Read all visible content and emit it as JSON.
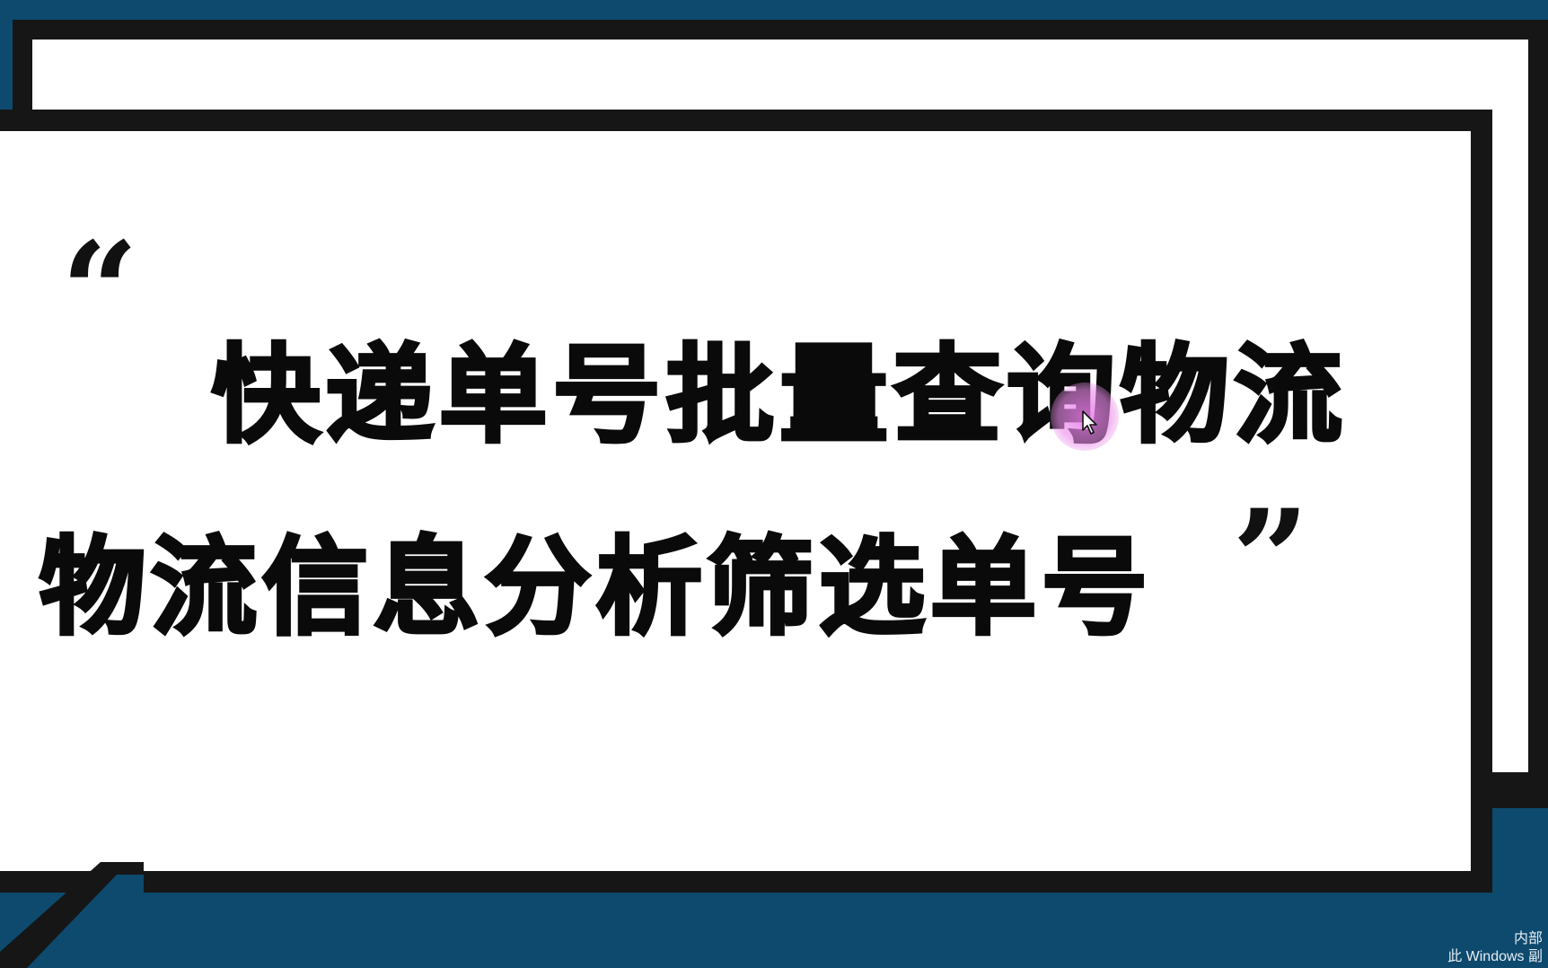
{
  "slide": {
    "quote_open": "“",
    "quote_close": "”",
    "title_line1": "快递单号批量查询物流",
    "title_line2": "物流信息分析筛选单号"
  },
  "watermark": {
    "line1": "内部",
    "line2": "此 Windows 副"
  },
  "colors": {
    "background": "#0d4a6e",
    "frame": "#161616",
    "card": "#ffffff",
    "text": "#0a0a0a",
    "cursor_highlight": "#e680e6"
  },
  "icons": {
    "cursor": "cursor-arrow-icon"
  }
}
